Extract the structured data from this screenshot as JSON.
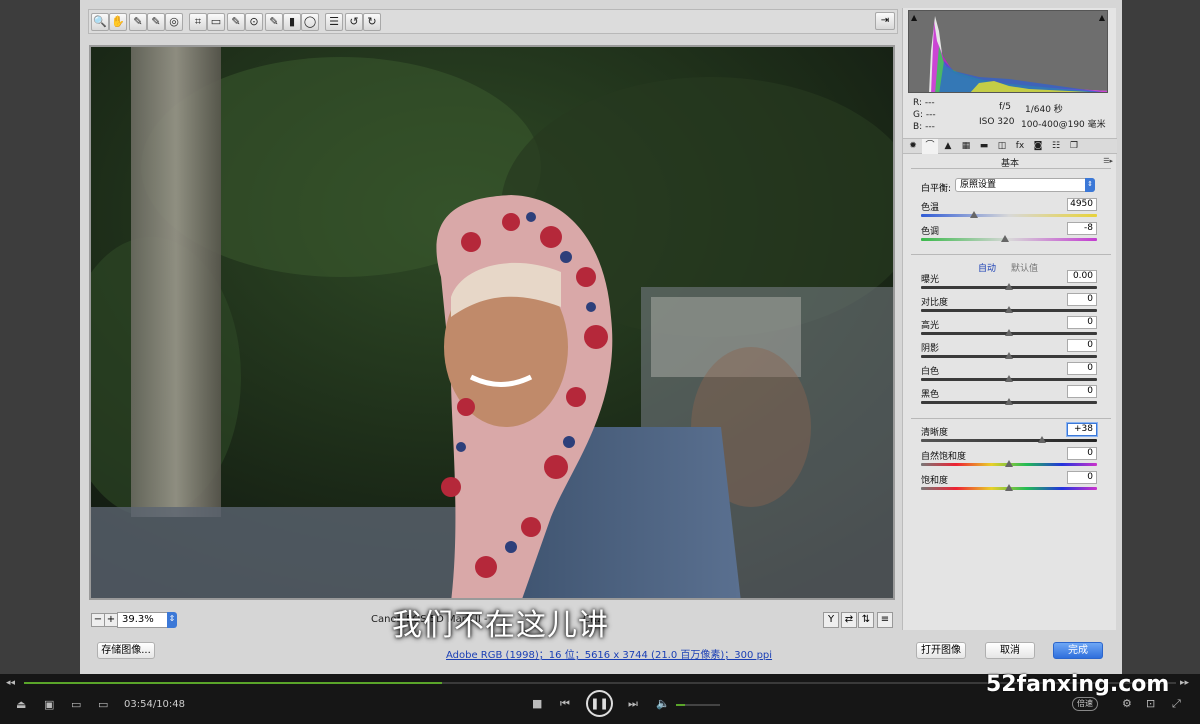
{
  "toolbar": {
    "tools": [
      {
        "icon": "zoom-icon",
        "glyph": "🔍"
      },
      {
        "icon": "hand-icon",
        "glyph": "✋"
      },
      {
        "icon": "white-balance-icon",
        "glyph": "✎"
      },
      {
        "icon": "color-sampler-icon",
        "glyph": "✎"
      },
      {
        "icon": "target-adjust-icon",
        "glyph": "◎"
      },
      {
        "icon": "crop-icon",
        "glyph": "⌗"
      },
      {
        "icon": "straighten-icon",
        "glyph": "▭"
      },
      {
        "icon": "spot-removal-icon",
        "glyph": "✎"
      },
      {
        "icon": "red-eye-icon",
        "glyph": "⊙"
      },
      {
        "icon": "adjustment-brush-icon",
        "glyph": "✎"
      },
      {
        "icon": "graduated-filter-icon",
        "glyph": "▮"
      },
      {
        "icon": "radial-filter-icon",
        "glyph": "◯"
      },
      {
        "icon": "preferences-icon",
        "glyph": "☰"
      },
      {
        "icon": "rotate-ccw-icon",
        "glyph": "↺"
      },
      {
        "icon": "rotate-cw-icon",
        "glyph": "↻"
      }
    ],
    "export_glyph": "⇥"
  },
  "preview": {
    "zoom": "39.3%",
    "camera": "Canon EOS 5D Mark II -",
    "ext_fragment": "CR2",
    "subtitle": "我们不在这儿讲"
  },
  "footer": {
    "save_label": "存储图像...",
    "info_link": "Adobe RGB (1998)；16 位；5616 x 3744 (21.0 百万像素)；300 ppi",
    "open_label": "打开图像",
    "cancel_label": "取消",
    "done_label": "完成"
  },
  "histogram": {
    "r": "R:   ---",
    "g": "G:   ---",
    "b": "B:   ---",
    "aperture": "f/5",
    "shutter": "1/640 秒",
    "iso": "ISO 320",
    "lens": "100-400@190 毫米"
  },
  "panel": {
    "section": "基本",
    "wb_label": "白平衡:",
    "wb_value": "原照设置",
    "auto": "自动",
    "default": "默认值",
    "accent": "#1a3fb5"
  },
  "sliders": [
    {
      "id": "temp",
      "label": "色温",
      "value": "4950",
      "pos": 0.3
    },
    {
      "id": "tint",
      "label": "色调",
      "value": "-8",
      "pos": 0.48
    },
    {
      "id": "exposure",
      "label": "曝光",
      "value": "0.00",
      "pos": 0.5
    },
    {
      "id": "contrast",
      "label": "对比度",
      "value": "0",
      "pos": 0.5
    },
    {
      "id": "highlights",
      "label": "高光",
      "value": "0",
      "pos": 0.5
    },
    {
      "id": "shadows",
      "label": "阴影",
      "value": "0",
      "pos": 0.5
    },
    {
      "id": "whites",
      "label": "白色",
      "value": "0",
      "pos": 0.5
    },
    {
      "id": "blacks",
      "label": "黑色",
      "value": "0",
      "pos": 0.5
    },
    {
      "id": "clarity",
      "label": "清晰度",
      "value": "+38",
      "pos": 0.69
    },
    {
      "id": "vibrance",
      "label": "自然饱和度",
      "value": "0",
      "pos": 0.5
    },
    {
      "id": "saturation",
      "label": "饱和度",
      "value": "0",
      "pos": 0.5
    }
  ],
  "player": {
    "time": "03:54/10:48",
    "progress": 0.363,
    "volume": 0.2,
    "speed": "倍速",
    "watermark": "52fanxing.com"
  }
}
